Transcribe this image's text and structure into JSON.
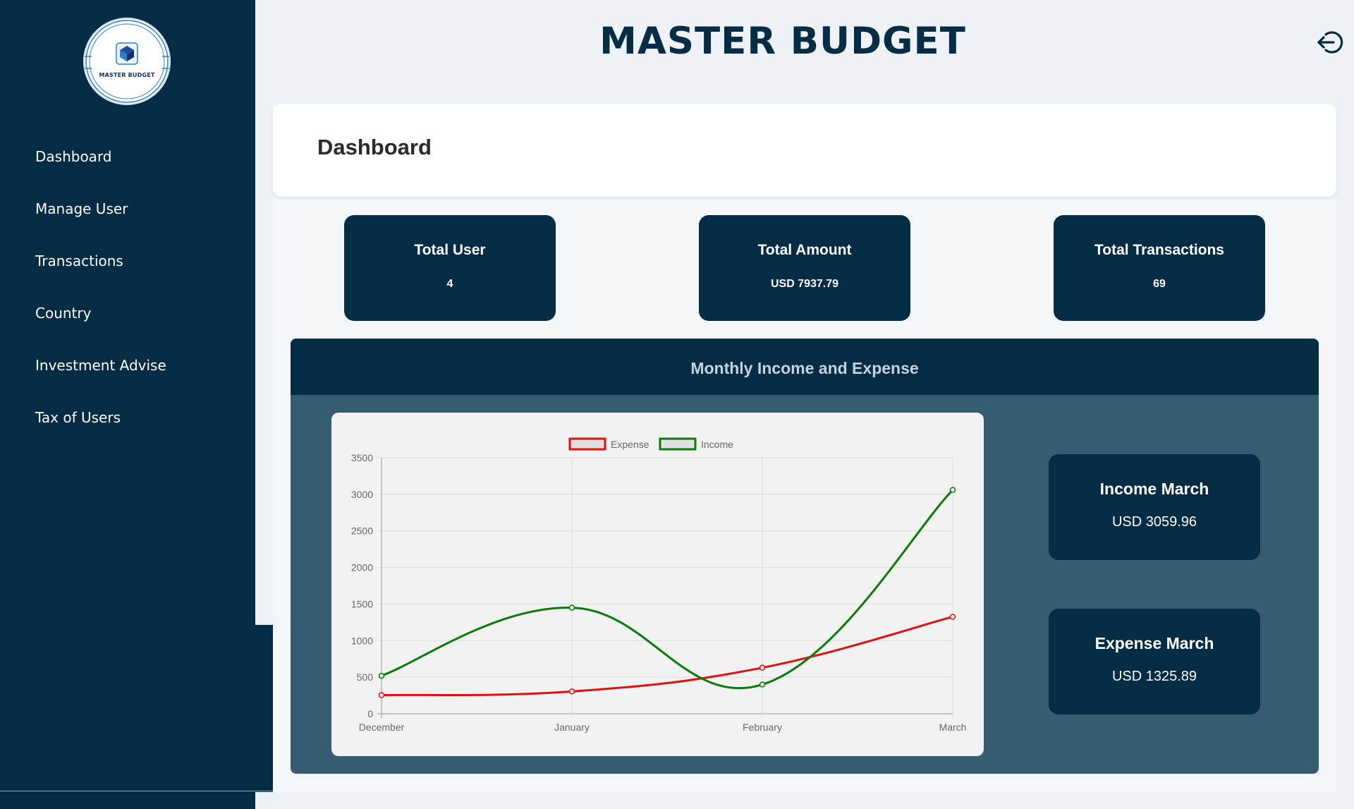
{
  "app": {
    "title": "MASTER BUDGET",
    "logo_text": "MASTER BUDGET"
  },
  "sidebar": {
    "items": [
      {
        "label": "Dashboard"
      },
      {
        "label": "Manage User"
      },
      {
        "label": "Transactions"
      },
      {
        "label": "Country"
      },
      {
        "label": "Investment Advise"
      },
      {
        "label": "Tax of Users"
      }
    ]
  },
  "header": {
    "logout_icon": "logout-icon"
  },
  "page": {
    "title": "Dashboard"
  },
  "stats": [
    {
      "title": "Total User",
      "value": "4"
    },
    {
      "title": "Total Amount",
      "value": "USD 7937.79"
    },
    {
      "title": "Total Transactions",
      "value": "69"
    }
  ],
  "panel": {
    "title": "Monthly Income and Expense"
  },
  "summary": {
    "income": {
      "title": "Income March",
      "value": "USD 3059.96"
    },
    "expense": {
      "title": "Expense March",
      "value": "USD 1325.89"
    }
  },
  "colors": {
    "sidebar": "#042c44",
    "panel": "#375b70",
    "expense": "#e01010",
    "income": "#0a7a0a"
  },
  "chart_data": {
    "type": "line",
    "categories": [
      "December",
      "January",
      "February",
      "March"
    ],
    "series": [
      {
        "name": "Expense",
        "color": "#e01010",
        "values": [
          255,
          305,
          630,
          1325.89
        ]
      },
      {
        "name": "Income",
        "color": "#0a7a0a",
        "values": [
          520,
          1450,
          400,
          3059.96
        ]
      }
    ],
    "ylim": [
      0,
      3500
    ],
    "yticks": [
      0,
      500,
      1000,
      1500,
      2000,
      2500,
      3000,
      3500
    ],
    "legend": "top",
    "grid": true
  }
}
